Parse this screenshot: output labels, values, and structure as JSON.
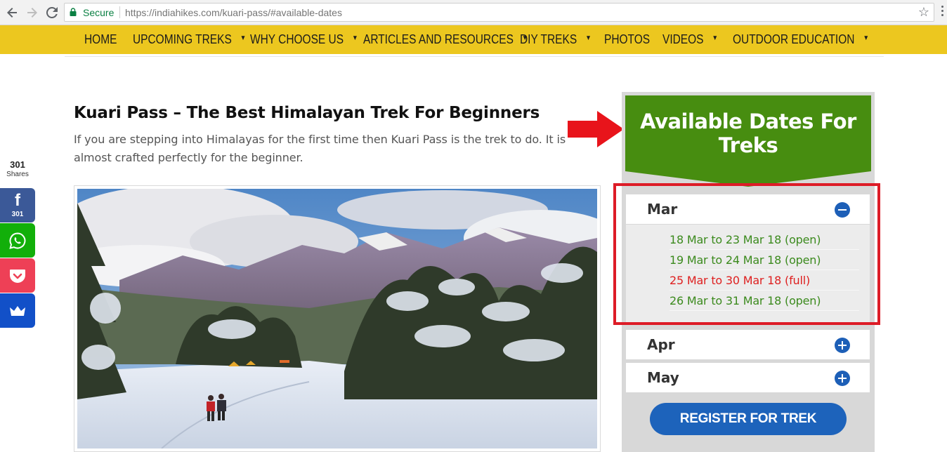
{
  "browser": {
    "secure_label": "Secure",
    "url_host": "https://indiahikes.com",
    "url_path": "/kuari-pass/#available-dates"
  },
  "nav": {
    "items": [
      {
        "label": "HOME",
        "caret": ""
      },
      {
        "label": "UPCOMING TREKS",
        "caret": "▼"
      },
      {
        "label": "WHY CHOOSE US",
        "caret": "▼"
      },
      {
        "label": "ARTICLES AND RESOURCES",
        "caret": "▼"
      },
      {
        "label": "DIY TREKS",
        "caret": "▼"
      },
      {
        "label": "PHOTOS",
        "caret": ""
      },
      {
        "label": "VIDEOS",
        "caret": "▼"
      },
      {
        "label": "OUTDOOR EDUCATION",
        "caret": "▼"
      }
    ]
  },
  "share": {
    "count": "301",
    "count_label": "Shares",
    "facebook_letter": "f",
    "facebook_count": "301"
  },
  "article": {
    "title": "Kuari Pass – The Best Himalayan Trek For Beginners",
    "lead": "If you are stepping into Himalayas for the first time then Kuari Pass is the trek to do. It is almost crafted perfectly for the beginner."
  },
  "widget": {
    "heading": "Available Dates For Treks",
    "months": [
      {
        "name": "Mar",
        "expanded": true
      },
      {
        "name": "Apr",
        "expanded": false
      },
      {
        "name": "May",
        "expanded": false
      }
    ],
    "dates": [
      {
        "label": "18 Mar to 23 Mar 18 (open)",
        "status": "open"
      },
      {
        "label": "19 Mar to 24 Mar 18 (open)",
        "status": "open"
      },
      {
        "label": "25 Mar to 30 Mar 18 (full)",
        "status": "full"
      },
      {
        "label": "26 Mar to 31 Mar 18 (open)",
        "status": "open"
      }
    ],
    "register_label": "REGISTER FOR TREK"
  },
  "colors": {
    "nav_bg": "#ecc71f",
    "widget_green": "#478d10",
    "open": "#3b8a1d",
    "full": "#de1f1f",
    "highlight": "#dd1c27",
    "button_blue": "#1d63bb"
  }
}
